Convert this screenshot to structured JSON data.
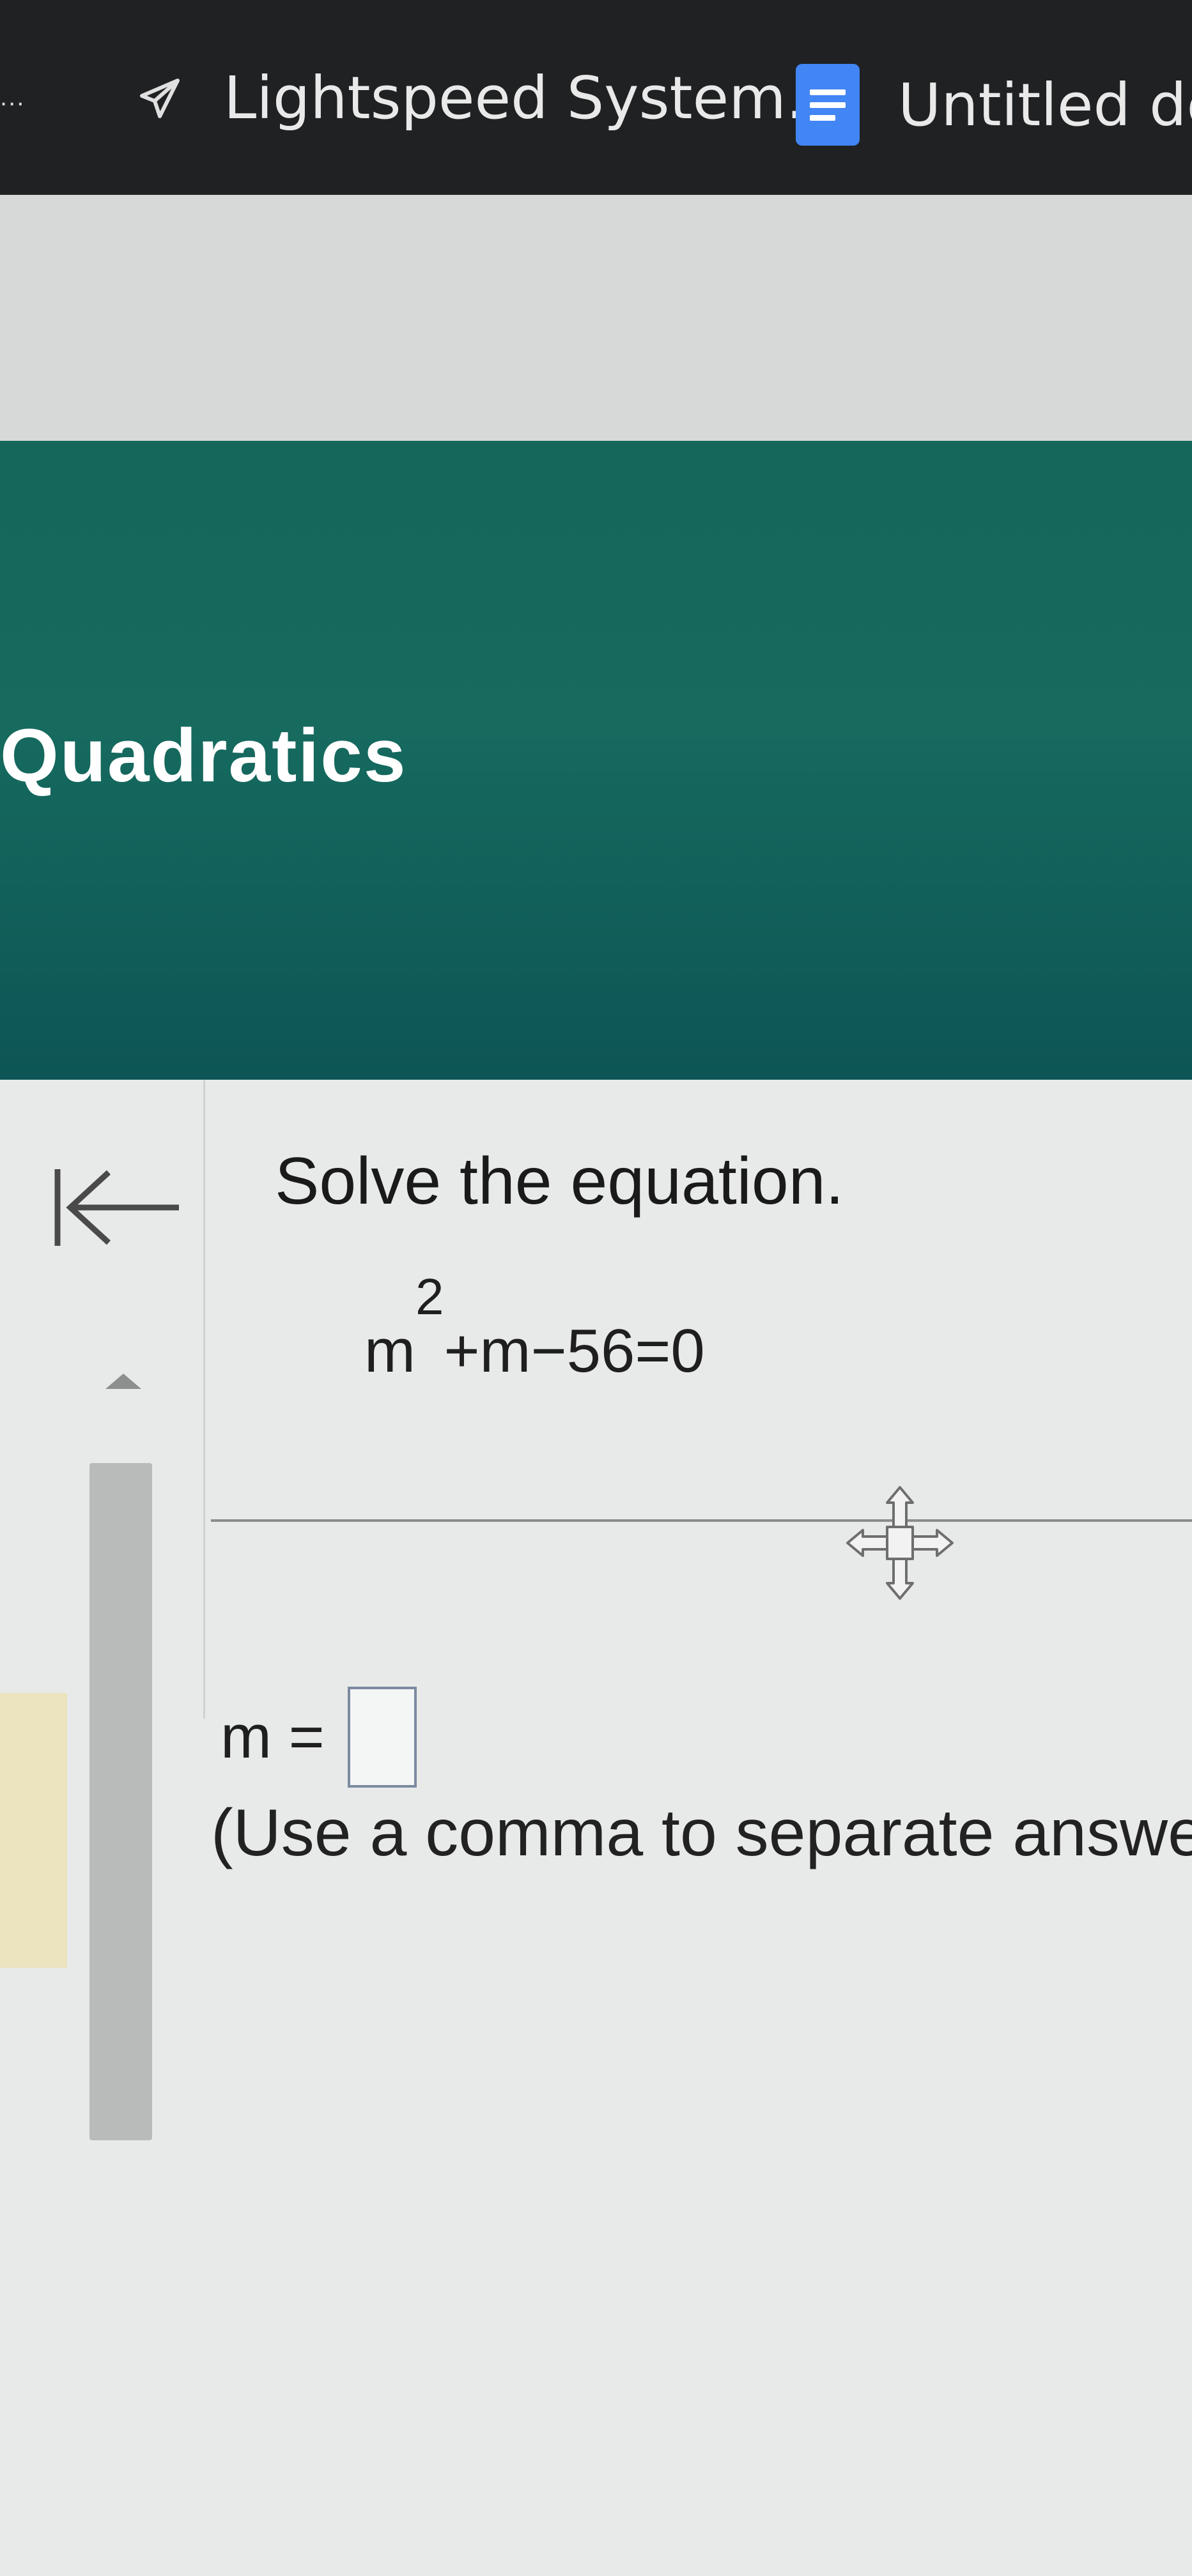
{
  "bookmarks_bar": {
    "overflow_label": "...",
    "items": [
      {
        "label": "Lightspeed System...",
        "icon": "paper-plane-icon"
      },
      {
        "label": "Untitled dc",
        "icon": "google-docs-icon"
      }
    ]
  },
  "banner": {
    "title": "Quadratics",
    "color": "#14675a"
  },
  "problem": {
    "instruction": "Solve the equation.",
    "equation": {
      "base": "m",
      "exponent": "2",
      "rest": "+m−56=0"
    },
    "answer_label": "m =",
    "answer_value": "",
    "hint": "(Use a comma to separate answer"
  },
  "icons": {
    "back": "back-to-start-icon",
    "cursor": "move-cursor-icon",
    "scroll": "scroll-up-arrow-icon"
  }
}
